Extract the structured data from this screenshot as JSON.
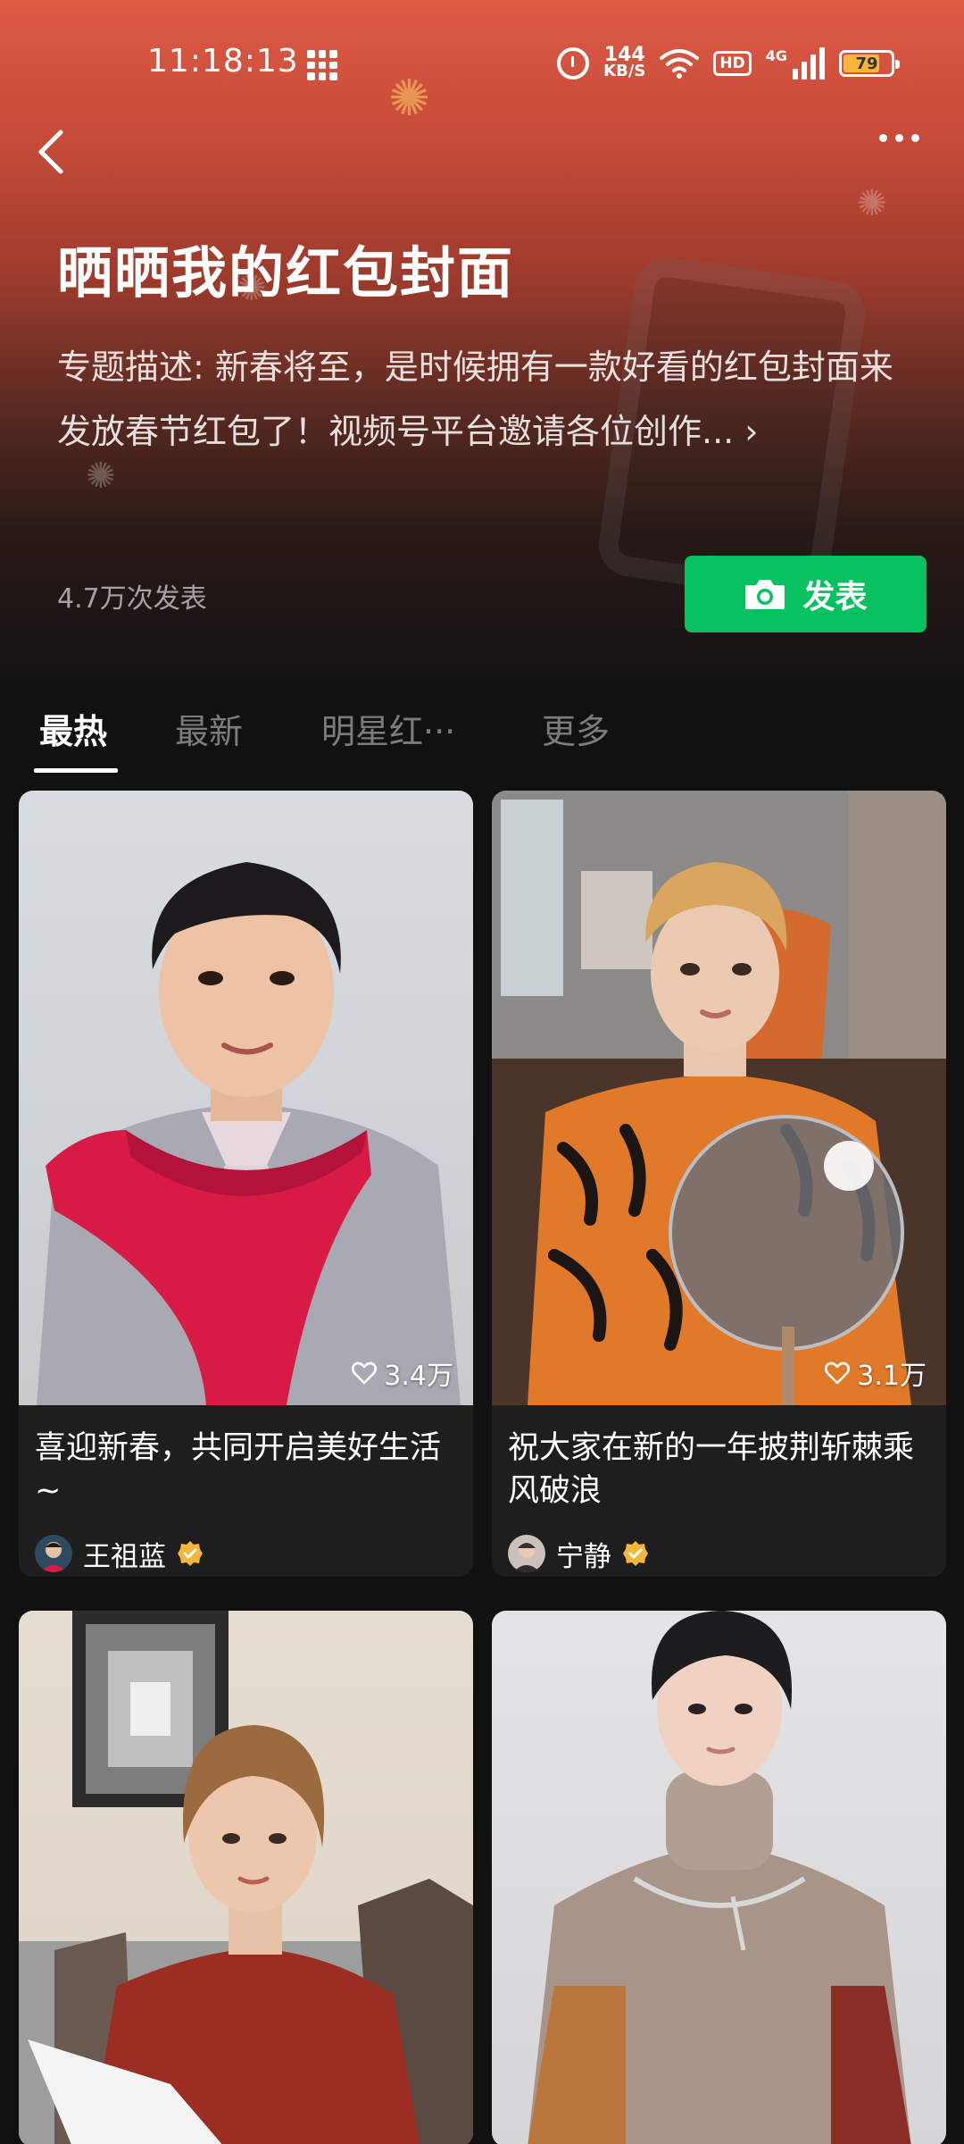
{
  "status_bar": {
    "time": "11:18:13",
    "speed_value": "144",
    "speed_unit": "KB/S",
    "hd": "HD",
    "network": "4G",
    "battery": "79",
    "battery_level": 0.79
  },
  "header": {
    "title": "晒晒我的红包封面",
    "description": "专题描述: 新春将至，是时候拥有一款好看的红包封面来发放春节红包了！视频号平台邀请各位创作...",
    "description_chevron": "›",
    "publish_count": "4.7万次发表",
    "publish_label": "发表"
  },
  "tabs": [
    {
      "label": "最热",
      "active": true
    },
    {
      "label": "最新",
      "active": false
    },
    {
      "label": "明星红···",
      "active": false
    },
    {
      "label": "更多",
      "active": false
    }
  ],
  "cards": [
    {
      "likes": "3.4万",
      "title": "喜迎新春，共同开启美好生活~",
      "author": "王祖蓝",
      "verified": true
    },
    {
      "likes": "3.1万",
      "title": "祝大家在新的一年披荆斩棘乘风破浪",
      "author": "宁静",
      "verified": true
    },
    {
      "likes": "",
      "title": "",
      "author": "",
      "verified": false
    },
    {
      "likes": "",
      "title": "",
      "author": "",
      "verified": false
    }
  ],
  "colors": {
    "accent_green": "#07c160",
    "header_red": "#dd5a45",
    "verified_gold": "#f5b63a",
    "background": "#111111"
  },
  "icons": [
    "back-icon",
    "more-icon",
    "camera-icon",
    "heart-icon",
    "verified-icon",
    "alarm-icon",
    "wifi-icon",
    "grid-icon"
  ]
}
